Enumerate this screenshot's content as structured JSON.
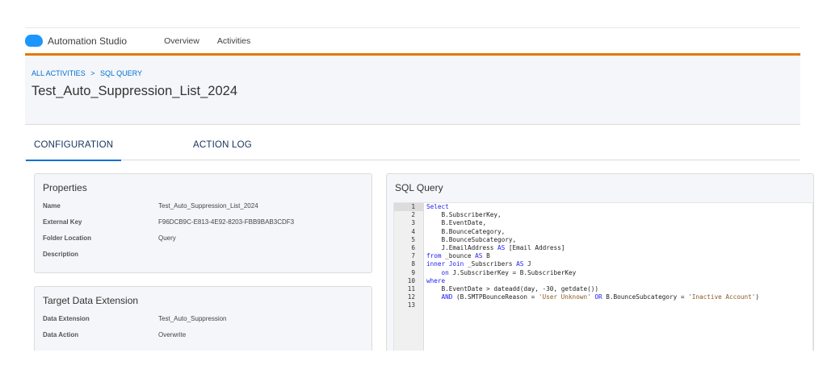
{
  "topbar": {
    "app_name": "Automation Studio",
    "nav": [
      "Overview",
      "Activities"
    ]
  },
  "breadcrumb": [
    "ALL ACTIVITIES",
    ">",
    "SQL QUERY"
  ],
  "page_title": "Test_Auto_Suppression_List_2024",
  "tabs": [
    "CONFIGURATION",
    "ACTION LOG"
  ],
  "properties": {
    "title": "Properties",
    "rows": [
      {
        "label": "Name",
        "value": "Test_Auto_Suppression_List_2024"
      },
      {
        "label": "External Key",
        "value": "F96DCB9C-E813-4E92-8203-FBB9BAB3CDF3"
      },
      {
        "label": "Folder Location",
        "value": "Query"
      },
      {
        "label": "Description",
        "value": ""
      }
    ]
  },
  "target": {
    "title": "Target Data Extension",
    "rows": [
      {
        "label": "Data Extension",
        "value": "Test_Auto_Suppression"
      },
      {
        "label": "Data Action",
        "value": "Overwrite"
      }
    ]
  },
  "sql": {
    "title": "SQL Query",
    "keywords": [
      "Select",
      "from",
      "AS",
      "inner",
      "Join",
      "on",
      "where",
      "AND",
      "OR"
    ],
    "lines": [
      "Select",
      "    B.SubscriberKey,",
      "    B.EventDate,",
      "    B.BounceCategory,",
      "    B.BounceSubcategory,",
      "    J.EmailAddress AS [Email Address]",
      "from _bounce AS B",
      "inner Join _Subscribers AS J",
      "    on J.SubscriberKey = B.SubscriberKey",
      "where",
      "    B.EventDate > dateadd(day, -30, getdate())",
      "    AND (B.SMTPBounceReason = 'User Unknown' OR B.BounceSubcategory = 'Inactive Account')",
      ""
    ]
  },
  "colors": {
    "accent": "#0070d2",
    "brand_bar": "#e07b00"
  }
}
